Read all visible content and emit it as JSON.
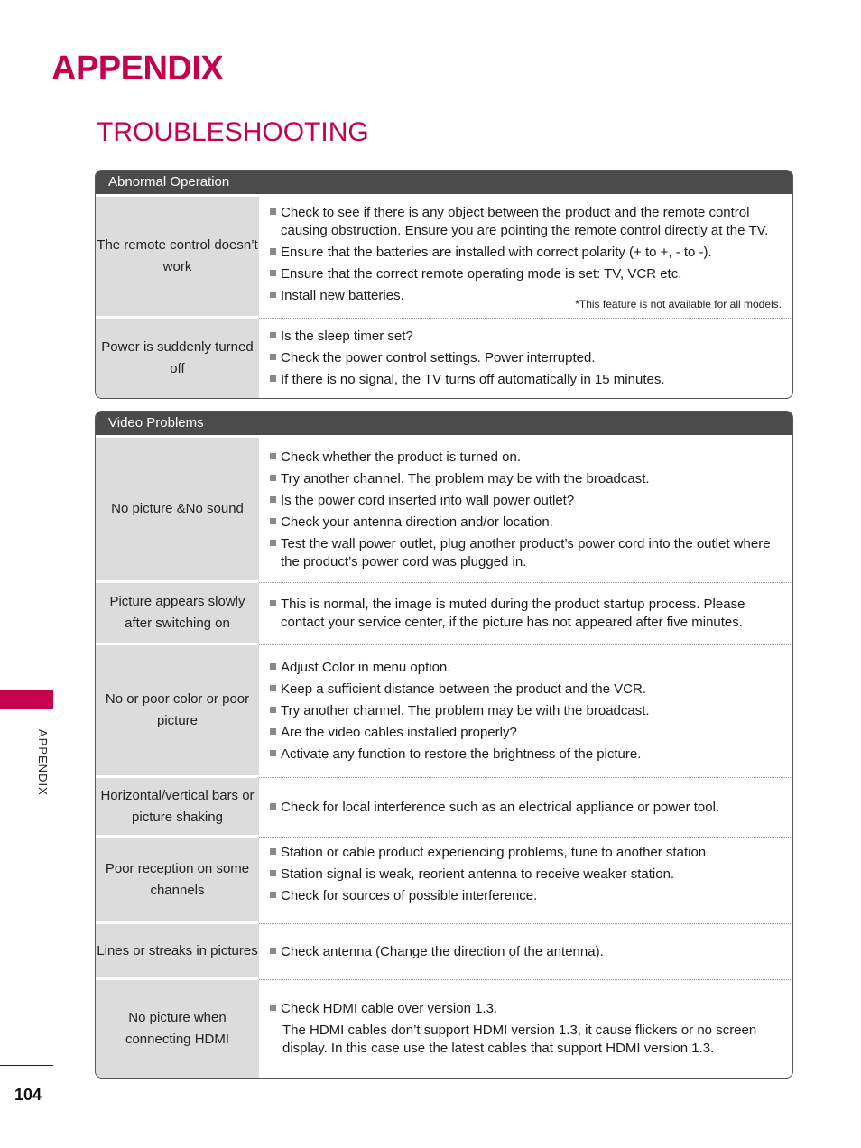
{
  "header": {
    "title": "APPENDIX",
    "section": "TROUBLESHOOTING"
  },
  "colors": {
    "accent": "#c4004f",
    "panel_header": "#4b4b4b",
    "label_bg": "#dcdcdc"
  },
  "sidebar": {
    "label": "APPENDIX"
  },
  "page_number": "104",
  "panels": [
    {
      "title": "Abnormal Operation",
      "rows": [
        {
          "label": "The remote control doesn’t work",
          "items": [
            "Check to see if there is any object between the product and the remote control causing obstruction. Ensure you are pointing the remote control directly at the TV.",
            "Ensure that the batteries are installed with correct polarity (+ to +, - to -).",
            "Ensure that the correct remote operating mode is set: TV, VCR etc.",
            "Install new batteries."
          ],
          "footnote": "*This feature is not available for all models."
        },
        {
          "label": "Power is suddenly turned off",
          "items": [
            "Is the sleep timer set?",
            "Check the power control settings. Power interrupted.",
            "If there is no signal, the TV turns off automatically in 15 minutes."
          ]
        }
      ]
    },
    {
      "title": "Video Problems",
      "rows": [
        {
          "label": "No picture &No sound",
          "items": [
            "Check whether the product is turned on.",
            "Try another channel. The problem may be with the broadcast.",
            "Is the power cord inserted into wall power outlet?",
            "Check your antenna direction and/or location.",
            "Test the wall power outlet, plug another product’s power cord into the outlet where the product’s power cord was plugged in."
          ]
        },
        {
          "label": "Picture appears slowly after switching on",
          "items": [
            "This is normal, the image is muted during the product startup process. Please contact your service center, if the picture has not appeared after five minutes."
          ]
        },
        {
          "label": "No or poor color or poor picture",
          "items": [
            "Adjust Color in menu option.",
            "Keep a sufficient distance between the product and the VCR.",
            "Try another channel. The problem may be with the broadcast.",
            "Are the video cables installed properly?",
            "Activate any function to restore the brightness of the picture."
          ]
        },
        {
          "label": "Horizontal/vertical bars or picture shaking",
          "items": [
            "Check for local interference such as an electrical appliance or power tool."
          ]
        },
        {
          "label": "Poor reception on some channels",
          "items": [
            "Station or cable product experiencing problems, tune to another station.",
            "Station signal is weak, reorient antenna to receive weaker station.",
            "Check for sources of possible interference."
          ]
        },
        {
          "label": "Lines or streaks in pictures",
          "items": [
            "Check antenna (Change the direction of the antenna)."
          ]
        },
        {
          "label": "No picture when connecting HDMI",
          "items": [
            "Check HDMI cable over version 1.3."
          ],
          "note": "The HDMI cables don’t support HDMI version 1.3, it cause flickers or no screen display. In this case use the latest cables that support HDMI version 1.3."
        }
      ]
    }
  ]
}
